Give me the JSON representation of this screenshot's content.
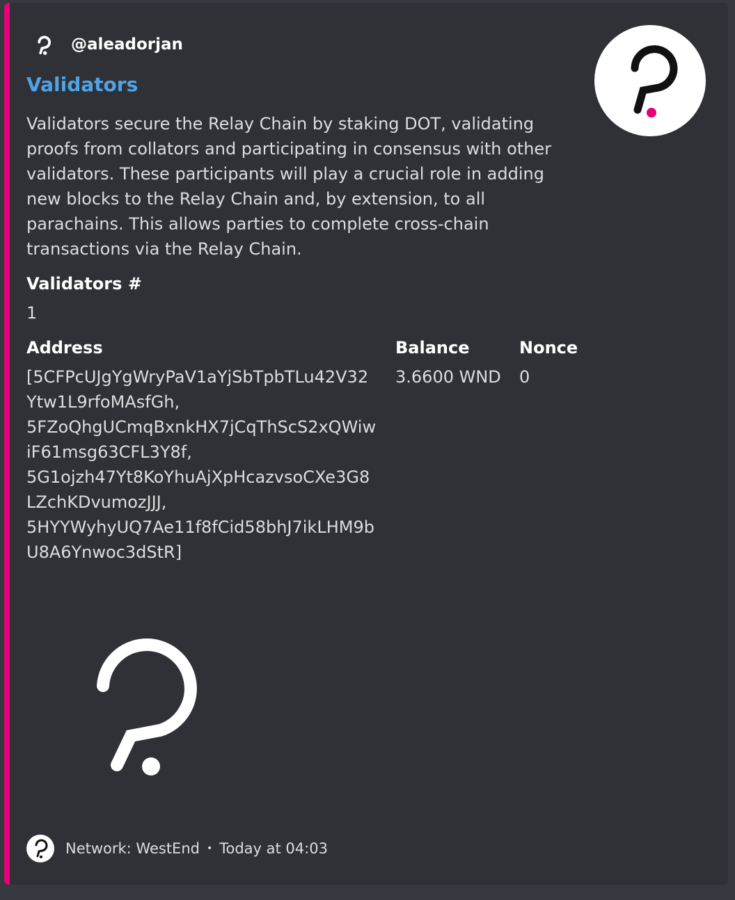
{
  "embed": {
    "accent_color": "#e6007a",
    "author": {
      "name": "@aleadorjan",
      "icon": "polkadot-logo-icon"
    },
    "title": "Validators",
    "description": "Validators secure the Relay Chain by staking DOT, validating proofs from collators and participating in consensus with other validators. These participants will play a crucial role in adding new blocks to the Relay Chain and, by extension, to all parachains. This allows parties to complete cross-chain transactions via the Relay Chain.",
    "fields": {
      "validators_count": {
        "name": "Validators #",
        "value": "1"
      },
      "address": {
        "name": "Address",
        "value": "[5CFPcUJgYgWryPaV1aYjSbTpbTLu42V32\nYtw1L9rfoMAsfGh,\n5FZoQhgUCmqBxnkHX7jCqThScS2xQWiw\niF61msg63CFL3Y8f,\n5G1ojzh47Yt8KoYhuAjXpHcazvsoCXe3G8\nLZchKDvumozJJJ,\n5HYYWyhyUQ7Ae11f8fCid58bhJ7ikLHM9b\nU8A6Ynwoc3dStR]"
      },
      "balance": {
        "name": "Balance",
        "value": "3.6600 WND"
      },
      "nonce": {
        "name": "Nonce",
        "value": "0"
      }
    },
    "thumbnail_icon": "polkadot-logo-icon",
    "image_icon": "polkadot-logo-icon",
    "footer": {
      "icon": "polkadot-logo-icon",
      "text": "Network: WestEnd",
      "separator": "•",
      "timestamp": "Today at 04:03"
    }
  }
}
